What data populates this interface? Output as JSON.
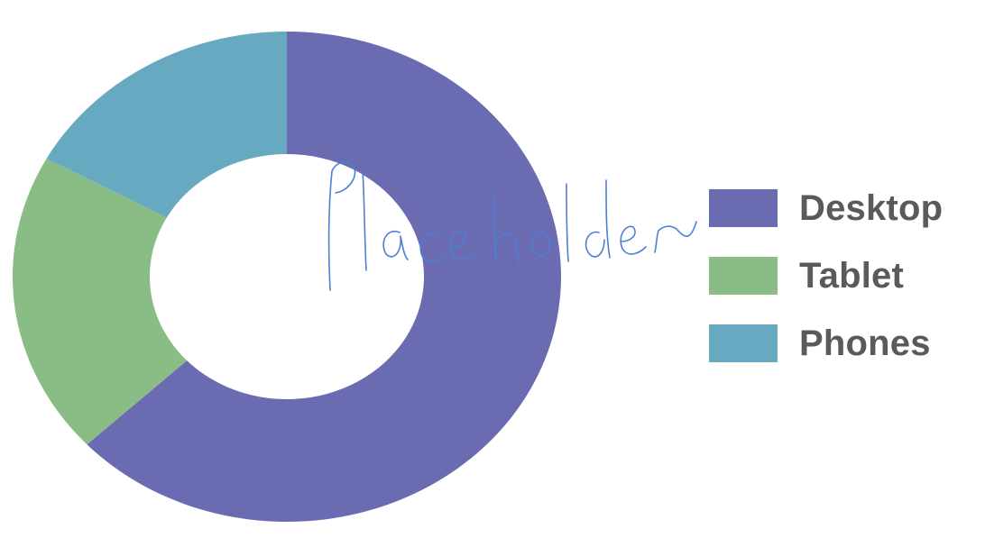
{
  "chart_data": {
    "type": "pie",
    "variant": "donut",
    "categories": [
      "Desktop",
      "Tablet",
      "Phones"
    ],
    "values": [
      63,
      20,
      17
    ],
    "colors": [
      "#6a6bb1",
      "#8abd86",
      "#67a9c0"
    ],
    "legend_position": "right",
    "start_angle_deg": 0,
    "direction": "clockwise"
  },
  "legend": {
    "items": [
      {
        "label": "Desktop",
        "color": "#6a6bb1"
      },
      {
        "label": "Tablet",
        "color": "#8abd86"
      },
      {
        "label": "Phones",
        "color": "#67a9c0"
      }
    ]
  },
  "overlay": {
    "handwritten_text": "Placeholder",
    "color": "#4a7fd6"
  }
}
